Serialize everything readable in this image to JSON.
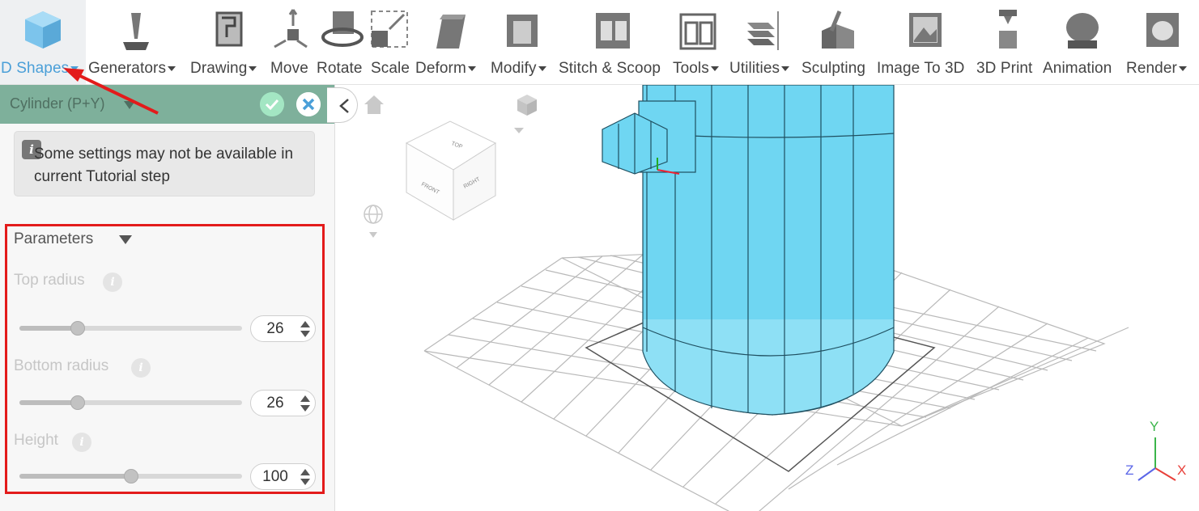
{
  "toolbar": {
    "tools": [
      {
        "label": "D Shapes",
        "caret": true,
        "icon": "cube-icon"
      },
      {
        "label": "Generators",
        "caret": true,
        "icon": "generator-icon"
      },
      {
        "label": "Drawing",
        "caret": true,
        "icon": "drawing-icon"
      },
      {
        "label": "Move",
        "caret": false,
        "icon": "move-icon"
      },
      {
        "label": "Rotate",
        "caret": false,
        "icon": "rotate-icon"
      },
      {
        "label": "Scale",
        "caret": false,
        "icon": "scale-icon"
      },
      {
        "label": "Deform",
        "caret": true,
        "icon": "deform-icon"
      },
      {
        "label": "Modify",
        "caret": true,
        "icon": "modify-icon"
      },
      {
        "label": "Stitch & Scoop",
        "caret": false,
        "icon": "stitch-scoop-icon"
      },
      {
        "label": "Tools",
        "caret": true,
        "icon": "tools-icon"
      },
      {
        "label": "Utilities",
        "caret": true,
        "icon": "utilities-icon"
      },
      {
        "label": "Sculpting",
        "caret": false,
        "icon": "sculpting-icon"
      },
      {
        "label": "Image To 3D",
        "caret": false,
        "icon": "image-to-3d-icon"
      },
      {
        "label": "3D Print",
        "caret": false,
        "icon": "3d-print-icon"
      },
      {
        "label": "Animation",
        "caret": false,
        "icon": "animation-icon"
      },
      {
        "label": "Render",
        "caret": true,
        "icon": "render-icon"
      }
    ]
  },
  "panel": {
    "title": "Cylinder (P+Y)",
    "notice": "Some settings may not be available in current Tutorial step",
    "section_title": "Parameters",
    "params": [
      {
        "label": "Top radius",
        "value": "26",
        "fraction": 0.26
      },
      {
        "label": "Bottom radius",
        "value": "26",
        "fraction": 0.26
      },
      {
        "label": "Height",
        "value": "100",
        "fraction": 0.5
      }
    ]
  },
  "viewcube": {
    "top": "TOP",
    "front": "FRONT",
    "right": "RIGHT"
  },
  "axes": {
    "x": "X",
    "y": "Y",
    "z": "Z"
  },
  "colors": {
    "accent": "#4a9fd8",
    "panel_header": "#7eb09b",
    "highlight": "#e31b1b",
    "model": "#6fd6f2"
  }
}
